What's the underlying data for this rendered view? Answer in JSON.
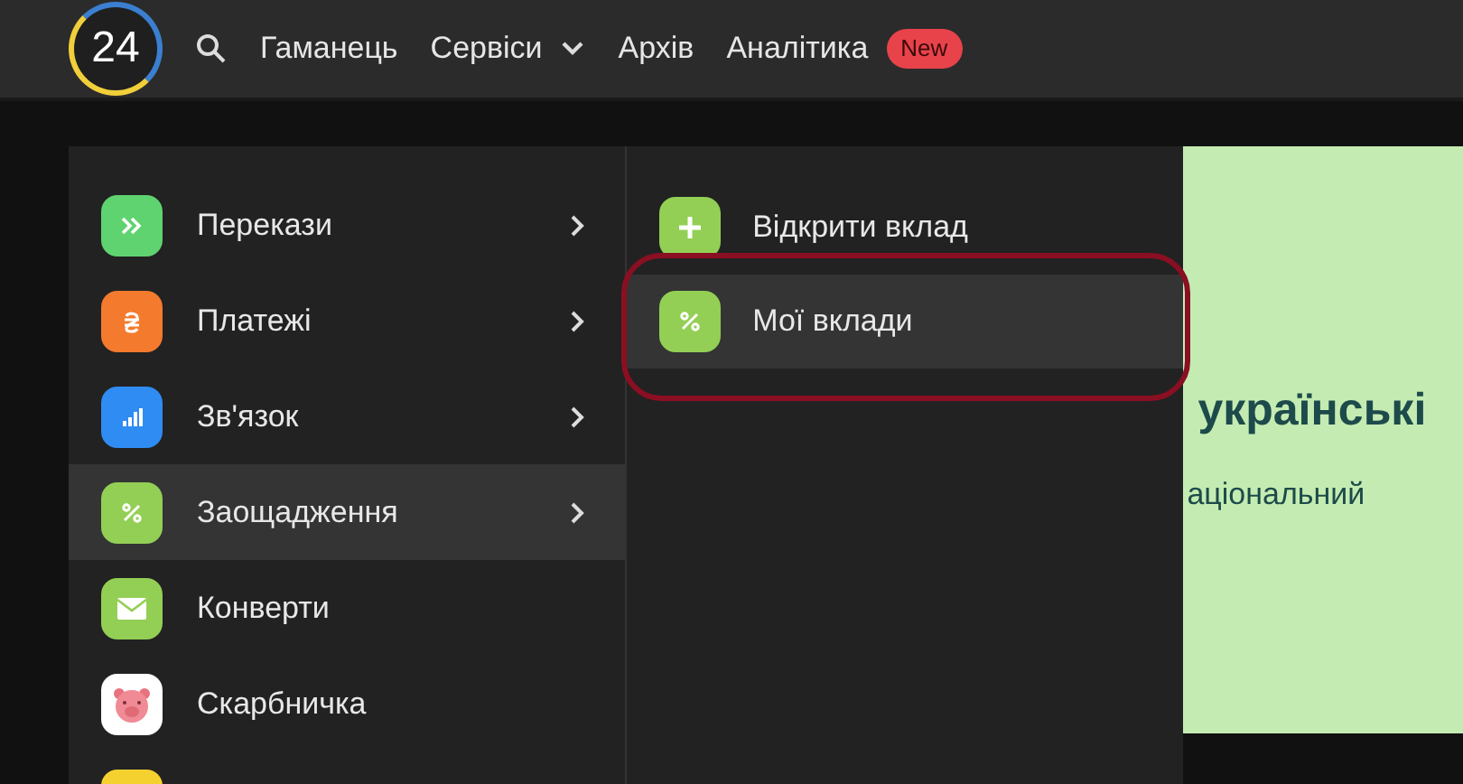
{
  "header": {
    "logo": "24",
    "nav": [
      {
        "label": "Гаманець",
        "dropdown": false
      },
      {
        "label": "Сервіси",
        "dropdown": true
      },
      {
        "label": "Архів",
        "dropdown": false
      },
      {
        "label": "Аналітика",
        "dropdown": false,
        "badge": "New"
      }
    ]
  },
  "menu": {
    "items": [
      {
        "label": "Перекази",
        "kind": "transfers",
        "color": "#5fd36f",
        "submenu": true,
        "selected": false
      },
      {
        "label": "Платежі",
        "kind": "payments",
        "color": "#f47a2d",
        "submenu": true,
        "selected": false
      },
      {
        "label": "Зв'язок",
        "kind": "signal",
        "color": "#2f8cf3",
        "submenu": true,
        "selected": false
      },
      {
        "label": "Заощадження",
        "kind": "percent",
        "color": "#93cf55",
        "submenu": true,
        "selected": true
      },
      {
        "label": "Конверти",
        "kind": "envelope",
        "color": "#93cf55",
        "submenu": false,
        "selected": false
      },
      {
        "label": "Скарбничка",
        "kind": "piggy",
        "color": "#ffffff",
        "submenu": false,
        "selected": false
      },
      {
        "kind": "blank",
        "color": "#f5d130",
        "submenu": false,
        "selected": false
      }
    ],
    "subitems": [
      {
        "label": "Відкрити вклад",
        "kind": "plus",
        "color": "#93cf55",
        "selected": false,
        "circled": false
      },
      {
        "label": "Мої вклади",
        "kind": "percent",
        "color": "#93cf55",
        "selected": true,
        "circled": true
      }
    ]
  },
  "banner": {
    "title": "українські",
    "subtitle": "аціональний"
  }
}
